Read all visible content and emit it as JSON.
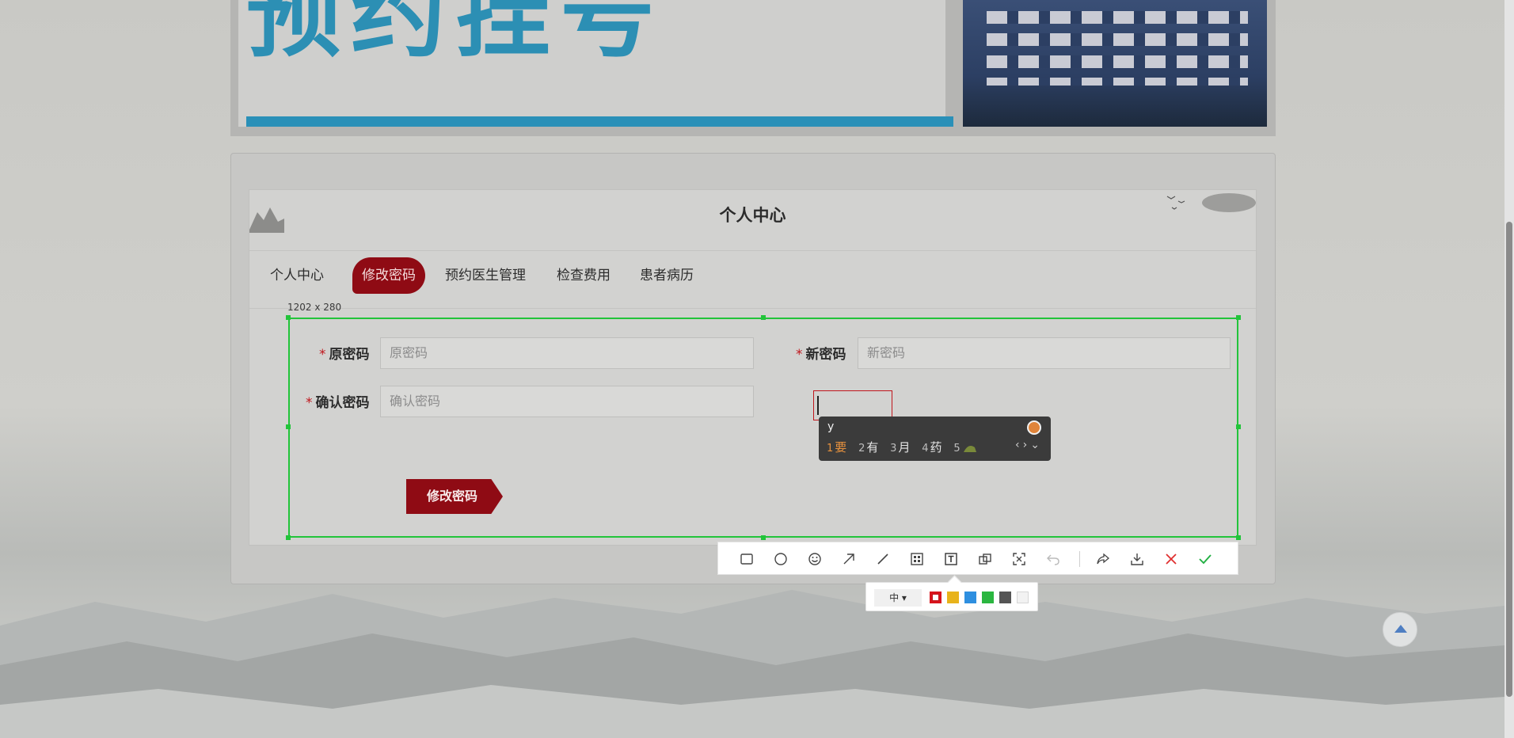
{
  "banner": {
    "title": "预约挂号"
  },
  "panel": {
    "title": "个人中心"
  },
  "tabs": [
    {
      "label": "个人中心"
    },
    {
      "label": "修改密码"
    },
    {
      "label": "预约医生管理"
    },
    {
      "label": "检查费用"
    },
    {
      "label": "患者病历"
    }
  ],
  "active_tab": "修改密码",
  "form": {
    "required_mark": "*",
    "old_password": {
      "label": "原密码",
      "placeholder": "原密码",
      "value": ""
    },
    "new_password": {
      "label": "新密码",
      "placeholder": "新密码",
      "value": ""
    },
    "confirm_password": {
      "label": "确认密码",
      "placeholder": "确认密码",
      "value": ""
    },
    "submit_label": "修改密码"
  },
  "capture": {
    "size_label": "1202 x 280"
  },
  "ime": {
    "input": "y",
    "candidates": [
      {
        "num": "1",
        "text": "要"
      },
      {
        "num": "2",
        "text": "有"
      },
      {
        "num": "3",
        "text": "月"
      },
      {
        "num": "4",
        "text": "药"
      },
      {
        "num": "5",
        "text": ""
      }
    ]
  },
  "toolbar": {
    "tools": [
      "rectangle-icon",
      "ellipse-icon",
      "emoji-icon",
      "arrow-icon",
      "line-icon",
      "mosaic-icon",
      "text-icon",
      "copy-icon",
      "ocr-icon",
      "undo-icon",
      "share-icon",
      "download-icon",
      "cancel-icon",
      "confirm-icon"
    ],
    "active_tool": "text-icon",
    "font_size": "中",
    "colors": [
      "#d8141c",
      "#e8b31b",
      "#2e8fe0",
      "#2bb640",
      "#555555",
      "#f2f2f2"
    ],
    "selected_color": "#d8141c"
  }
}
